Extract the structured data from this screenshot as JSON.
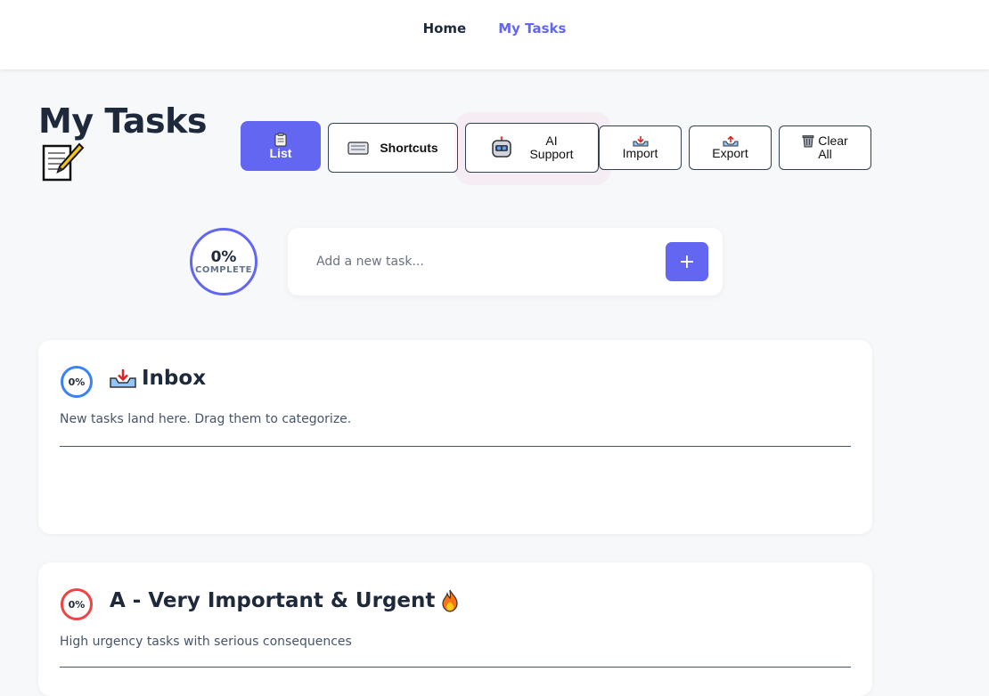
{
  "nav": {
    "home": "Home",
    "my_tasks": "My Tasks"
  },
  "page": {
    "title": "My Tasks",
    "title_icon": "memo-icon"
  },
  "toolbar": {
    "list_label": "List",
    "shortcuts_label": "Shortcuts",
    "ai_line1": "AI",
    "ai_line2": "Support",
    "import_label": "Import",
    "export_label": "Export",
    "clear_line1": "Clear",
    "clear_line2": "All"
  },
  "progress": {
    "value": "0%",
    "label": "COMPLETE"
  },
  "add_task": {
    "placeholder": "Add a new task...",
    "button": "+"
  },
  "categories": [
    {
      "progress": "0%",
      "icon": "inbox-tray-icon",
      "title": "Inbox",
      "description": "New tasks land here. Drag them to categorize."
    },
    {
      "progress": "0%",
      "icon": "fire-icon",
      "title": "A - Very Important & Urgent",
      "description": "High urgency tasks with serious consequences"
    }
  ],
  "colors": {
    "accent": "#6366f1",
    "inbox_ring": "#3b82f6",
    "urgent_ring": "#ef4444",
    "background": "#f7f8fa"
  }
}
